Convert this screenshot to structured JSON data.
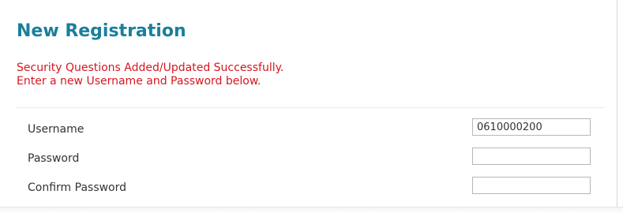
{
  "page": {
    "title": "New Registration"
  },
  "message": {
    "line1": "Security Questions Added/Updated Successfully.",
    "line2": "Enter a new Username and Password below.",
    "color": "#d6171f"
  },
  "form": {
    "username": {
      "label": "Username",
      "value": "0610000200"
    },
    "password": {
      "label": "Password",
      "value": ""
    },
    "confirm_password": {
      "label": "Confirm Password",
      "value": ""
    }
  },
  "colors": {
    "title": "#1a7f9a",
    "text": "#333333",
    "input_border": "#b6b6b6"
  }
}
